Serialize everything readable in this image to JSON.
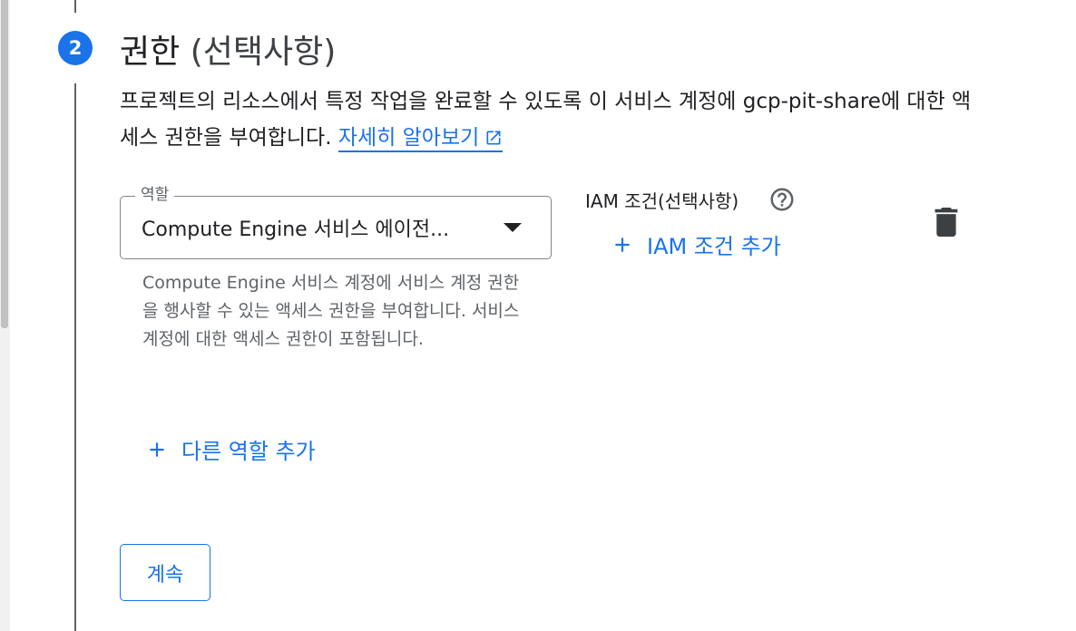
{
  "step": {
    "number": "2",
    "title": "권한",
    "title_optional": "(선택사항)",
    "description": "프로젝트의 리소스에서 특정 작업을 완료할 수 있도록 이 서비스 계정에 gcp-pit-share에 대한 액세스 권한을 부여합니다.",
    "learn_more": "자세히 알아보기"
  },
  "role": {
    "label": "역할",
    "value": "Compute Engine 서비스 에이전...",
    "help_text": "Compute Engine 서비스 계정에 서비스 계정 권한을 행사할 수 있는 액세스 권한을 부여합니다. 서비스 계정에 대한 액세스 권한이 포함됩니다."
  },
  "iam_condition": {
    "title": "IAM 조건(선택사항)",
    "add_label": "IAM 조건 추가"
  },
  "add_role_label": "다른 역할 추가",
  "continue_label": "계속",
  "icons": {
    "step": "step-number-badge",
    "external_link": "open-in-new-icon",
    "dropdown": "dropdown-arrow-icon",
    "help": "help-outline-icon",
    "add": "plus-icon",
    "delete": "trash-icon"
  },
  "colors": {
    "accent": "#1a73e8",
    "text": "#202124",
    "secondary_text": "#5f6368",
    "border": "#80868b"
  }
}
